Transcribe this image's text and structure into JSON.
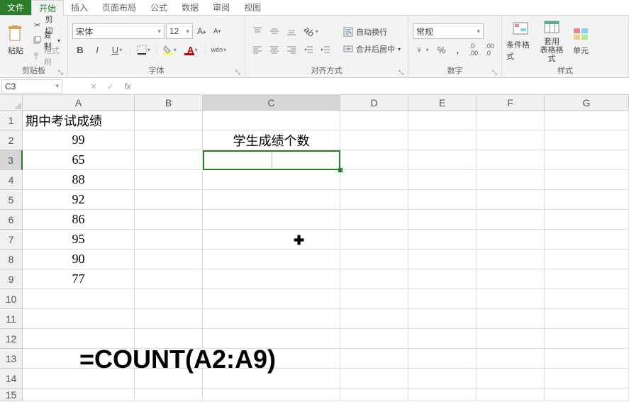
{
  "tabs": {
    "file": "文件",
    "home": "开始",
    "insert": "插入",
    "layout": "页面布局",
    "formulas": "公式",
    "data": "数据",
    "review": "审阅",
    "view": "视图"
  },
  "ribbon": {
    "clipboard": {
      "paste": "粘贴",
      "cut": "剪切",
      "copy": "复制",
      "format_painter": "格式刷",
      "group_label": "剪贴板"
    },
    "font": {
      "name": "宋体",
      "size": "12",
      "group_label": "字体",
      "bold": "B",
      "italic": "I",
      "underline": "U",
      "wen": "wén"
    },
    "align": {
      "wrap": "自动换行",
      "merge": "合并后居中",
      "group_label": "对齐方式"
    },
    "number": {
      "format": "常规",
      "group_label": "数字"
    },
    "styles": {
      "cond": "条件格式",
      "table": "套用\n表格格式",
      "cell": "单元",
      "group_label": "样式"
    }
  },
  "namebox": "C3",
  "formula": "",
  "columns": [
    "A",
    "B",
    "C",
    "D",
    "E",
    "F",
    "G"
  ],
  "rows": [
    "1",
    "2",
    "3",
    "4",
    "5",
    "6",
    "7",
    "8",
    "9",
    "10",
    "11",
    "12",
    "13",
    "14",
    "15"
  ],
  "cells": {
    "A1": "期中考试成绩",
    "A2": "99",
    "A3": "65",
    "A4": "88",
    "A5": "92",
    "A6": "86",
    "A7": "95",
    "A8": "90",
    "A9": "77",
    "C2": "学生成绩个数"
  },
  "overlay_formula": "=COUNT(A2:A9)",
  "fx_buttons": {
    "cancel": "✕",
    "enter": "✓",
    "fx": "fx"
  }
}
